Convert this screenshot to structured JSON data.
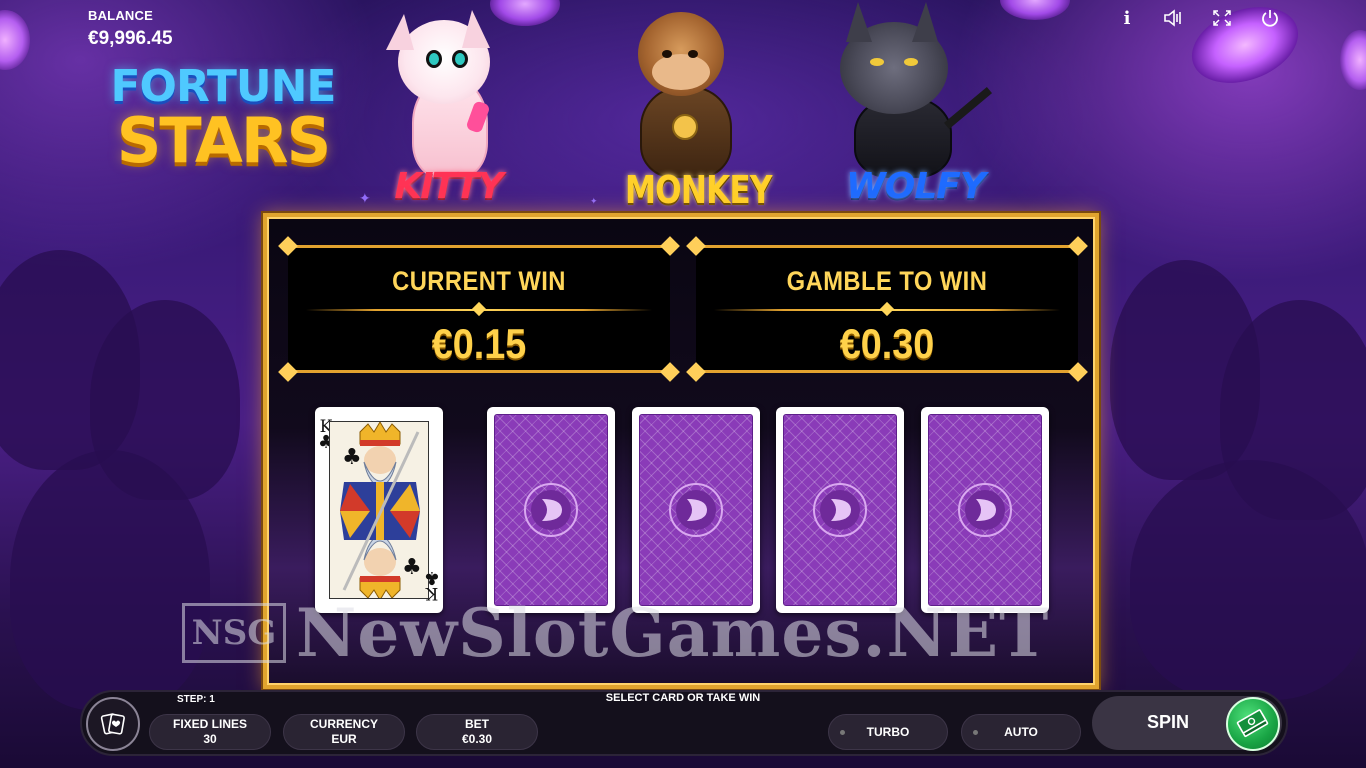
{
  "balance": {
    "label": "BALANCE",
    "value": "€9,996.45"
  },
  "logo": {
    "line1": "FORTUNE",
    "line2": "STARS"
  },
  "top_icons": [
    "info-icon",
    "sound-icon",
    "fullscreen-icon",
    "power-icon"
  ],
  "characters": [
    {
      "name": "KITTY",
      "color": "#ff3355"
    },
    {
      "name": "MONKEY",
      "color": "#ffd02a"
    },
    {
      "name": "WOLFY",
      "color": "#1e6bff"
    }
  ],
  "gamble": {
    "current_win": {
      "title": "CURRENT WIN",
      "value": "€0.15"
    },
    "gamble_to_win": {
      "title": "GAMBLE TO WIN",
      "value": "€0.30"
    },
    "dealer_card": {
      "rank": "K",
      "suit": "♣"
    },
    "face_down_cards": 4
  },
  "watermark": "NewSlotGames.NET",
  "watermark_logo": "NSG",
  "bottom_bar": {
    "step": "STEP: 1",
    "message": "SELECT CARD OR TAKE WIN",
    "fixed_lines": {
      "label": "FIXED LINES",
      "value": "30"
    },
    "currency": {
      "label": "CURRENCY",
      "value": "EUR"
    },
    "bet": {
      "label": "BET",
      "value": "€0.30"
    },
    "turbo": "TURBO",
    "auto": "AUTO",
    "spin": "SPIN"
  },
  "colors": {
    "gold": "#e0a42e",
    "card_back": "#8a3bb8",
    "spin_green": "#18a444"
  }
}
